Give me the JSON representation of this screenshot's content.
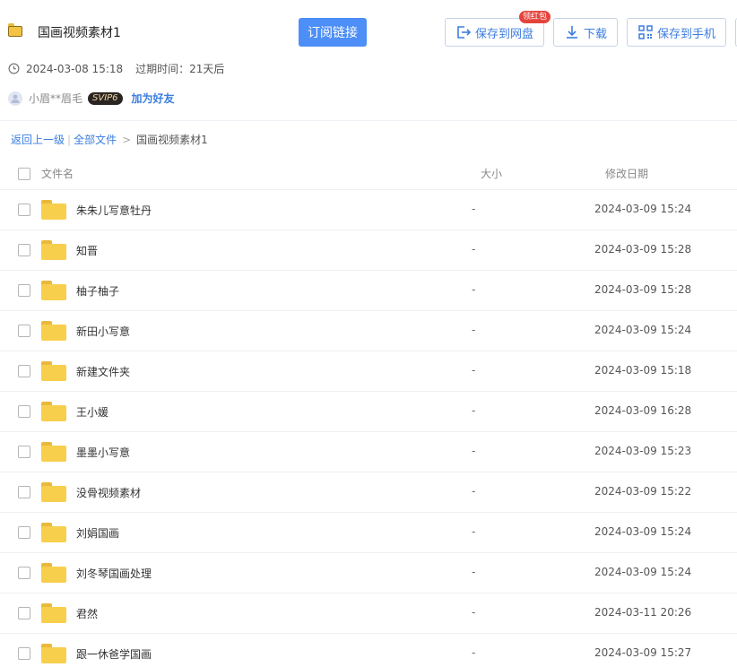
{
  "header": {
    "title": "国画视频素材1",
    "subscribe_label": "订阅链接",
    "save_to_netdisk_label": "保存到网盘",
    "red_packet_badge": "领红包",
    "download_label": "下载",
    "save_to_phone_label": "保存到手机"
  },
  "meta": {
    "share_time": "2024-03-08 15:18",
    "expire_text": "过期时间：21天后"
  },
  "user": {
    "name": "小眉**眉毛",
    "vip_badge": "SVIP6",
    "add_friend_label": "加为好友"
  },
  "breadcrumb": {
    "back_label": "返回上一级",
    "all_files_label": "全部文件",
    "current": "国画视频素材1"
  },
  "table": {
    "columns": {
      "name": "文件名",
      "size": "大小",
      "modified": "修改日期"
    },
    "rows": [
      {
        "name": "朱朱儿写意牡丹",
        "size": "-",
        "date": "2024-03-09 15:24"
      },
      {
        "name": "知晋",
        "size": "-",
        "date": "2024-03-09 15:28"
      },
      {
        "name": "柚子柚子",
        "size": "-",
        "date": "2024-03-09 15:28"
      },
      {
        "name": "新田小写意",
        "size": "-",
        "date": "2024-03-09 15:24"
      },
      {
        "name": "新建文件夹",
        "size": "-",
        "date": "2024-03-09 15:18"
      },
      {
        "name": "王小媛",
        "size": "-",
        "date": "2024-03-09 16:28"
      },
      {
        "name": "墨墨小写意",
        "size": "-",
        "date": "2024-03-09 15:23"
      },
      {
        "name": "没骨视频素材",
        "size": "-",
        "date": "2024-03-09 15:22"
      },
      {
        "name": "刘娟国画",
        "size": "-",
        "date": "2024-03-09 15:24"
      },
      {
        "name": "刘冬琴国画处理",
        "size": "-",
        "date": "2024-03-09 15:24"
      },
      {
        "name": "君然",
        "size": "-",
        "date": "2024-03-11 20:26"
      },
      {
        "name": "跟一休爸学国画",
        "size": "-",
        "date": "2024-03-09 15:27"
      }
    ]
  },
  "colors": {
    "primary": "#4d8ef7",
    "link": "#3b7de0",
    "folder": "#f8cf4c",
    "badge_red": "#e5443c"
  }
}
